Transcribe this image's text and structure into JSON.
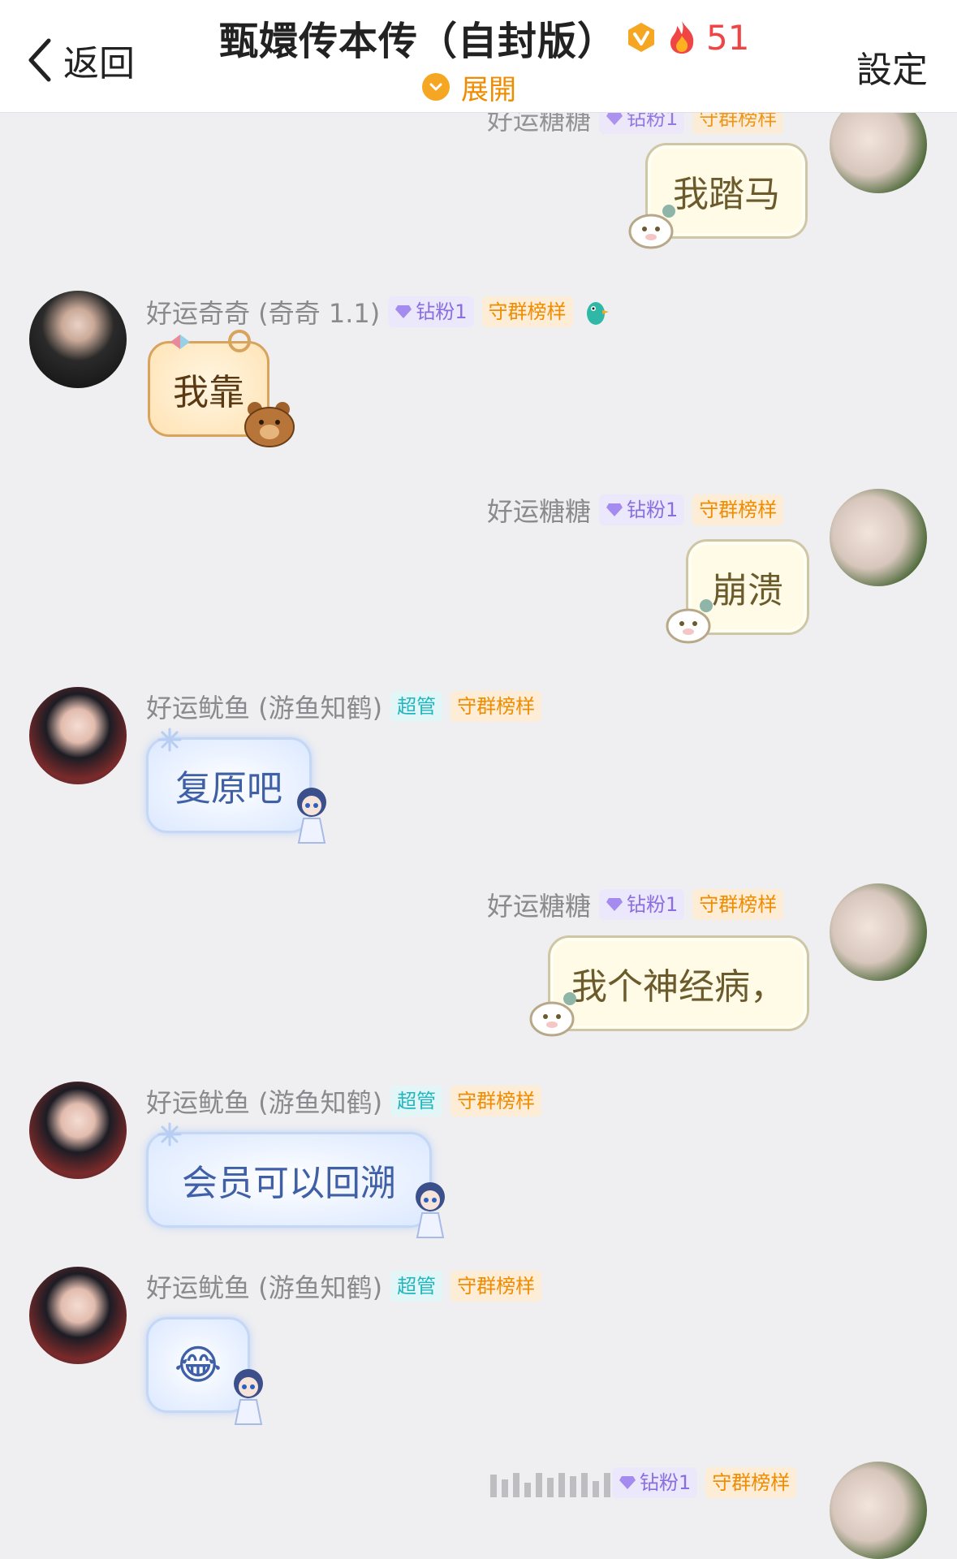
{
  "header": {
    "back_label": "返回",
    "title": "甄嬛传本传（自封版）",
    "fire_count": "51",
    "expand_label": "展開",
    "settings_label": "設定"
  },
  "badges": {
    "diamond": "钻粉1",
    "guard": "守群榜样",
    "admin": "超管"
  },
  "messages": [
    {
      "sender": "好运糖糖",
      "text": "我踏马"
    },
    {
      "sender": "好运奇奇 (奇奇 1.1)",
      "text": "我靠"
    },
    {
      "sender": "好运糖糖",
      "text": "崩溃"
    },
    {
      "sender": "好运鱿鱼 (游鱼知鹤)",
      "text": "复原吧"
    },
    {
      "sender": "好运糖糖",
      "text": "我个神经病，"
    },
    {
      "sender": "好运鱿鱼 (游鱼知鹤)",
      "text": "会员可以回溯"
    },
    {
      "sender": "好运鱿鱼 (游鱼知鹤)",
      "text": "😂"
    }
  ],
  "colors": {
    "accent_orange": "#f5a623",
    "fire_red": "#f04545",
    "admin_teal": "#20b6c0",
    "diamond_purple": "#8a6de0"
  }
}
